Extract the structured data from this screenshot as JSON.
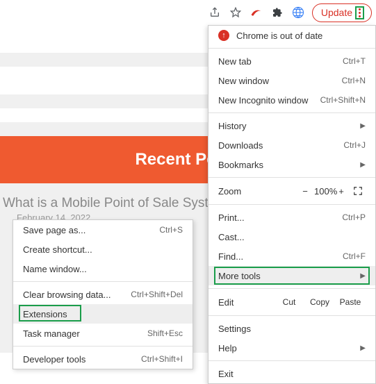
{
  "toolbar": {
    "update": "Update"
  },
  "page": {
    "recent_posts": "Recent Posts",
    "post_title": "What is a Mobile Point of Sale System",
    "post_date": "February 14, 2022"
  },
  "menu": {
    "out_of_date": "Chrome is out of date",
    "new_tab": "New tab",
    "new_tab_sc": "Ctrl+T",
    "new_window": "New window",
    "new_window_sc": "Ctrl+N",
    "new_incognito": "New Incognito window",
    "new_incognito_sc": "Ctrl+Shift+N",
    "history": "History",
    "downloads": "Downloads",
    "downloads_sc": "Ctrl+J",
    "bookmarks": "Bookmarks",
    "zoom_label": "Zoom",
    "zoom_minus": "−",
    "zoom_pct": "100%",
    "zoom_plus": "+",
    "print": "Print...",
    "print_sc": "Ctrl+P",
    "cast": "Cast...",
    "find": "Find...",
    "find_sc": "Ctrl+F",
    "more_tools": "More tools",
    "edit": "Edit",
    "cut": "Cut",
    "copy": "Copy",
    "paste": "Paste",
    "settings": "Settings",
    "help": "Help",
    "exit": "Exit"
  },
  "submenu": {
    "save_page": "Save page as...",
    "save_page_sc": "Ctrl+S",
    "create_shortcut": "Create shortcut...",
    "name_window": "Name window...",
    "clear_data": "Clear browsing data...",
    "clear_data_sc": "Ctrl+Shift+Del",
    "extensions": "Extensions",
    "task_manager": "Task manager",
    "task_manager_sc": "Shift+Esc",
    "dev_tools": "Developer tools",
    "dev_tools_sc": "Ctrl+Shift+I"
  }
}
